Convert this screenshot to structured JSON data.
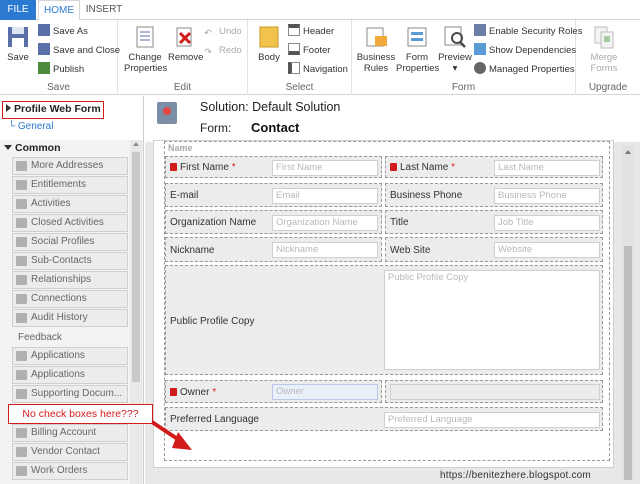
{
  "tabs": {
    "file": "FILE",
    "home": "HOME",
    "insert": "INSERT"
  },
  "ribbon": {
    "save": {
      "save": "Save",
      "save_as": "Save As",
      "save_close": "Save and Close",
      "publish": "Publish",
      "group": "Save"
    },
    "edit": {
      "change_properties_1": "Change",
      "change_properties_2": "Properties",
      "remove": "Remove",
      "undo": "Undo",
      "redo": "Redo",
      "group": "Edit"
    },
    "select": {
      "body": "Body",
      "header": "Header",
      "footer": "Footer",
      "navigation": "Navigation",
      "group": "Select"
    },
    "form": {
      "business_rules_1": "Business",
      "business_rules_2": "Rules",
      "form_properties_1": "Form",
      "form_properties_2": "Properties",
      "preview": "Preview",
      "enable_security": "Enable Security Roles",
      "show_dependencies": "Show Dependencies",
      "managed_properties": "Managed Properties",
      "group": "Form"
    },
    "upgrade": {
      "merge_forms_1": "Merge",
      "merge_forms_2": "Forms",
      "group": "Upgrade"
    }
  },
  "nav": {
    "form_title": "Profile Web Form",
    "general": "General",
    "common": "Common",
    "items": [
      "More Addresses",
      "Entitlements",
      "Activities",
      "Closed Activities",
      "Social Profiles",
      "Sub-Contacts",
      "Relationships",
      "Connections",
      "Audit History"
    ],
    "feedback": "Feedback",
    "items2": [
      "Applications",
      "Applications",
      "Supporting Docum...",
      "Billing Account",
      "Vendor Contact",
      "Work Orders"
    ]
  },
  "main": {
    "solution": "Solution: Default Solution",
    "form_label": "Form:",
    "form_name": "Contact",
    "section_title": "Name"
  },
  "fields": {
    "first_name": {
      "label": "First Name",
      "req": "*",
      "placeholder": "First Name"
    },
    "last_name": {
      "label": "Last Name",
      "req": "*",
      "placeholder": "Last Name"
    },
    "email": {
      "label": "E-mail",
      "placeholder": "Email"
    },
    "business_phone": {
      "label": "Business Phone",
      "placeholder": "Business Phone"
    },
    "org_name": {
      "label": "Organization Name",
      "placeholder": "Organization Name"
    },
    "title": {
      "label": "Title",
      "placeholder": "Job Title"
    },
    "nickname": {
      "label": "Nickname",
      "placeholder": "Nickname"
    },
    "website": {
      "label": "Web Site",
      "placeholder": "Website"
    },
    "public_profile": {
      "label": "Public Profile Copy",
      "placeholder": "Public Profile Copy"
    },
    "owner": {
      "label": "Owner",
      "req": "*",
      "placeholder": "Owner"
    },
    "pref_lang": {
      "label": "Preferred Language",
      "placeholder": "Preferred Language"
    }
  },
  "annotation": {
    "text": "No check boxes here???"
  },
  "watermark": "https://benitezhere.blogspot.com",
  "colors": {
    "accent": "#2b79d0",
    "annotation_red": "#d21c1c"
  }
}
